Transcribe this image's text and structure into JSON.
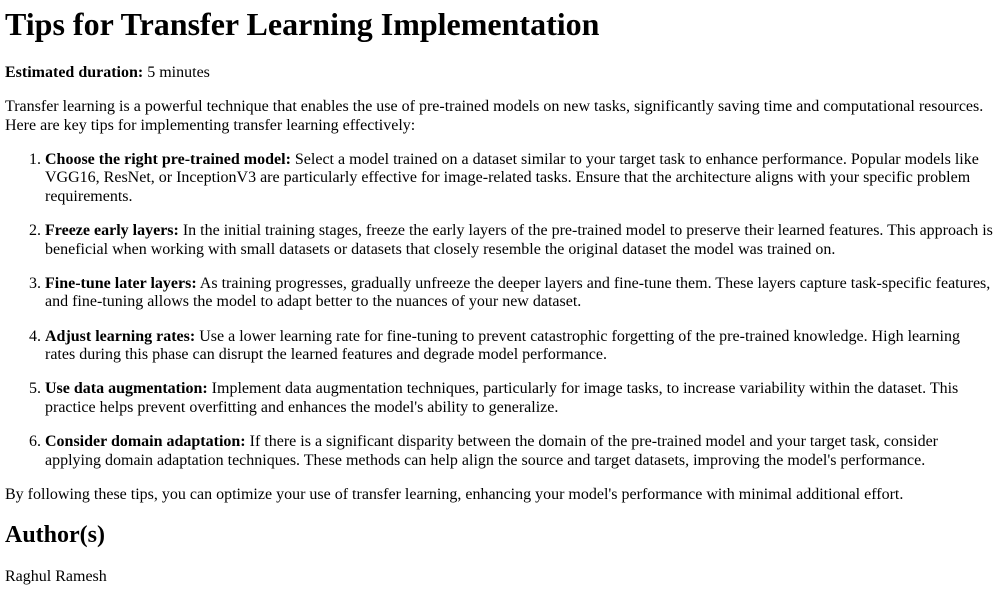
{
  "title": "Tips for Transfer Learning Implementation",
  "duration": {
    "label": "Estimated duration:",
    "value": " 5 minutes"
  },
  "intro": "Transfer learning is a powerful technique that enables the use of pre-trained models on new tasks, significantly saving time and computational resources. Here are key tips for implementing transfer learning effectively:",
  "tips": [
    {
      "title": "Choose the right pre-trained model:",
      "text": " Select a model trained on a dataset similar to your target task to enhance performance. Popular models like VGG16, ResNet, or InceptionV3 are particularly effective for image-related tasks. Ensure that the architecture aligns with your specific problem requirements."
    },
    {
      "title": "Freeze early layers:",
      "text": " In the initial training stages, freeze the early layers of the pre-trained model to preserve their learned features. This approach is beneficial when working with small datasets or datasets that closely resemble the original dataset the model was trained on."
    },
    {
      "title": "Fine-tune later layers:",
      "text": " As training progresses, gradually unfreeze the deeper layers and fine-tune them. These layers capture task-specific features, and fine-tuning allows the model to adapt better to the nuances of your new dataset."
    },
    {
      "title": "Adjust learning rates:",
      "text": " Use a lower learning rate for fine-tuning to prevent catastrophic forgetting of the pre-trained knowledge. High learning rates during this phase can disrupt the learned features and degrade model performance."
    },
    {
      "title": "Use data augmentation:",
      "text": " Implement data augmentation techniques, particularly for image tasks, to increase variability within the dataset. This practice helps prevent overfitting and enhances the model's ability to generalize."
    },
    {
      "title": "Consider domain adaptation:",
      "text": " If there is a significant disparity between the domain of the pre-trained model and your target task, consider applying domain adaptation techniques. These methods can help align the source and target datasets, improving the model's performance."
    }
  ],
  "conclusion": "By following these tips, you can optimize your use of transfer learning, enhancing your model's performance with minimal additional effort.",
  "authors_heading": "Author(s)",
  "author": "Raghul Ramesh"
}
